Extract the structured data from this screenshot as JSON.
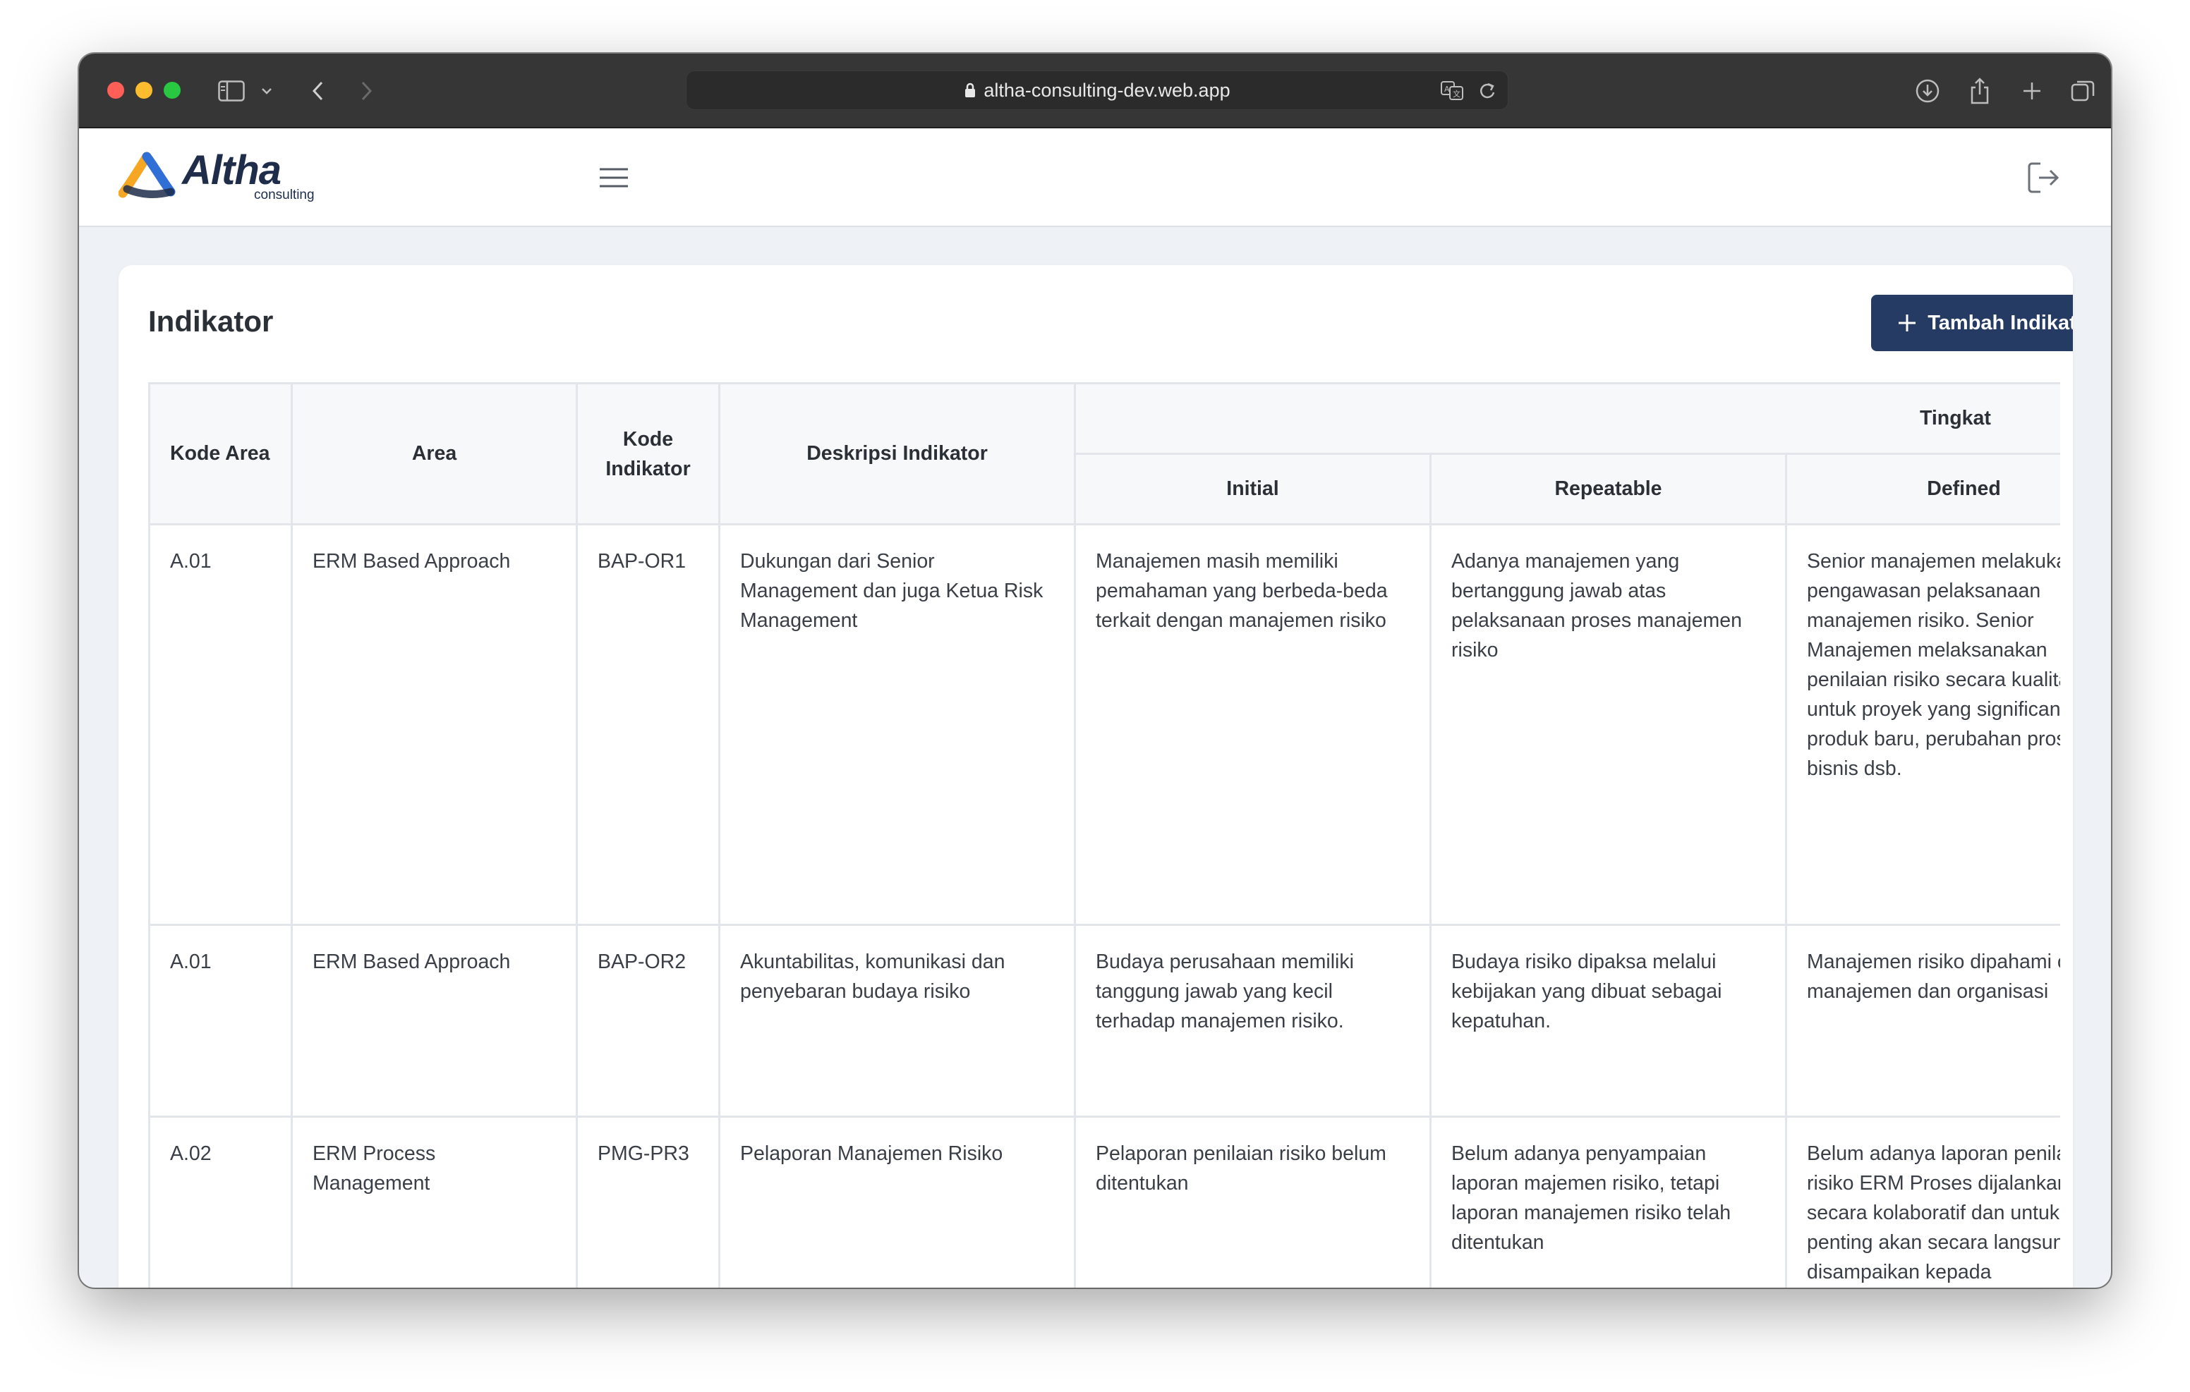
{
  "browser": {
    "url": "altha-consulting-dev.web.app"
  },
  "header": {
    "logo_text": "Altha",
    "logo_subtext": "consulting"
  },
  "page": {
    "title": "Indikator",
    "add_button_label": "Tambah Indikator"
  },
  "table": {
    "headers": {
      "kode_area": "Kode Area",
      "area": "Area",
      "kode_indikator": "Kode Indikator",
      "deskripsi": "Deskripsi Indikator",
      "tingkat": "Tingkat",
      "levels": [
        "Initial",
        "Repeatable",
        "Defined"
      ]
    },
    "rows": [
      {
        "kode_area": "A.01",
        "area": "ERM Based Approach",
        "kode_indikator": "BAP-OR1",
        "deskripsi": "Dukungan dari Senior Management dan juga Ketua Risk Management",
        "initial": "Manajemen masih memiliki pemahaman yang berbeda-beda terkait dengan manajemen risiko",
        "repeatable": "Adanya manajemen yang bertanggung jawab atas pelaksanaan proses manajemen risiko",
        "defined": "Senior manajemen melakukan pengawasan pelaksanaan manajemen risiko. Senior Manajemen melaksanakan penilaian risiko secara kualitatif untuk proyek yang significant, produk baru, perubahan proses bisnis dsb."
      },
      {
        "kode_area": "A.01",
        "area": "ERM Based Approach",
        "kode_indikator": "BAP-OR2",
        "deskripsi": "Akuntabilitas, komunikasi dan penyebaran budaya risiko",
        "initial": "Budaya perusahaan memiliki tanggung jawab yang kecil terhadap manajemen risiko.",
        "repeatable": "Budaya risiko dipaksa melalui kebijakan yang dibuat sebagai kepatuhan.",
        "defined": "Manajemen risiko dipahami oleh manajemen dan organisasi"
      },
      {
        "kode_area": "A.02",
        "area": "ERM Process Management",
        "kode_indikator": "PMG-PR3",
        "deskripsi": "Pelaporan Manajemen Risiko",
        "initial": "Pelaporan penilaian risiko belum ditentukan",
        "repeatable": "Belum adanya penyampaian laporan majemen risiko, tetapi laporan manajemen risiko telah ditentukan",
        "defined": "Belum adanya laporan penilaian risiko ERM Proses dijalankan secara kolaboratif dan untuk isu penting akan secara langsung disampaikan kepada"
      }
    ]
  }
}
